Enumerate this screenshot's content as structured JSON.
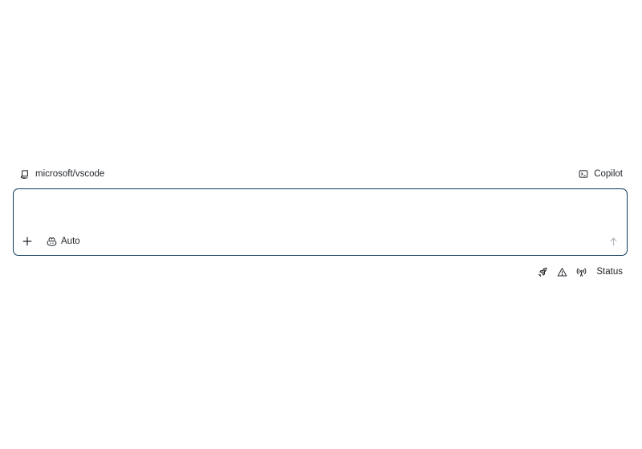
{
  "repo": {
    "name": "microsoft/vscode",
    "icon": "repo-icon"
  },
  "agent": {
    "label": "Copilot",
    "icon": "terminal-icon"
  },
  "composer": {
    "placeholder": "",
    "value": "",
    "add_icon": "plus-icon",
    "model": {
      "label": "Auto",
      "icon": "copilot-icon"
    },
    "send_icon": "arrow-up-icon",
    "border_color": "#0b3b5c"
  },
  "status_bar": {
    "icons": [
      "rocket-icon",
      "warning-icon",
      "broadcast-icon"
    ],
    "label": "Status"
  }
}
